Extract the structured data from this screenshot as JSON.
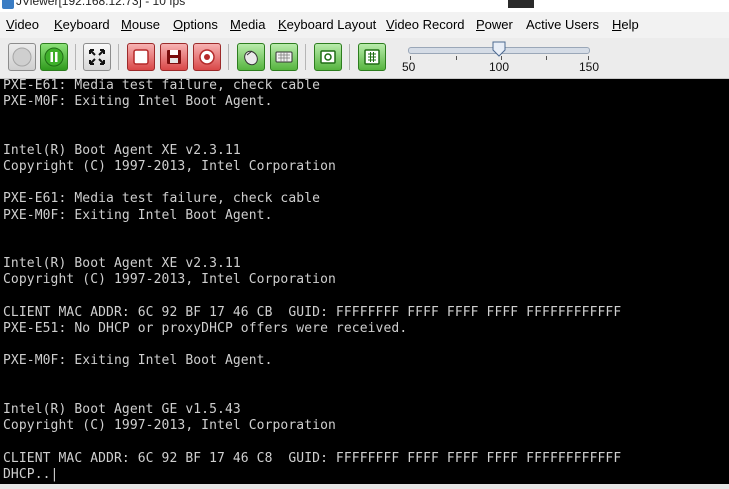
{
  "window": {
    "title": "JViewer[192.168.12.73] - 10 fps"
  },
  "menu": [
    {
      "label": "Video",
      "mnemonic": "V",
      "rest": "ideo"
    },
    {
      "label": "Keyboard",
      "mnemonic": "K",
      "rest": "eyboard"
    },
    {
      "label": "Mouse",
      "mnemonic": "M",
      "rest": "ouse"
    },
    {
      "label": "Options",
      "mnemonic": "O",
      "rest": "ptions"
    },
    {
      "label": "Media",
      "mnemonic": "M",
      "rest": "edia"
    },
    {
      "label": "Keyboard Layout",
      "mnemonic": "K",
      "rest": "eyboard Layout"
    },
    {
      "label": "Video Record",
      "mnemonic": "V",
      "rest": "ideo Record"
    },
    {
      "label": "Power",
      "mnemonic": "P",
      "rest": "ower"
    },
    {
      "label": "Active Users",
      "mnemonic": "",
      "rest": "Active Users"
    },
    {
      "label": "Help",
      "mnemonic": "H",
      "rest": "elp"
    }
  ],
  "toolbar": {
    "icons": [
      "play-icon",
      "pause-icon",
      "fullscreen-icon",
      "stop-record-icon",
      "save-icon",
      "settings-icon",
      "mouse-icon",
      "keyboard-icon",
      "virtual-media-icon",
      "soft-keyboard-icon"
    ],
    "zoom": {
      "min_label": "50",
      "mid_label": "100",
      "max_label": "150",
      "value": 100
    }
  },
  "console": {
    "lines": [
      "PXE-E61: Media test failure, check cable",
      "PXE-M0F: Exiting Intel Boot Agent.",
      "",
      "",
      "Intel(R) Boot Agent XE v2.3.11",
      "Copyright (C) 1997-2013, Intel Corporation",
      "",
      "PXE-E61: Media test failure, check cable",
      "PXE-M0F: Exiting Intel Boot Agent.",
      "",
      "",
      "Intel(R) Boot Agent XE v2.3.11",
      "Copyright (C) 1997-2013, Intel Corporation",
      "",
      "CLIENT MAC ADDR: 6C 92 BF 17 46 CB  GUID: FFFFFFFF FFFF FFFF FFFF FFFFFFFFFFFF",
      "PXE-E51: No DHCP or proxyDHCP offers were received.",
      "",
      "PXE-M0F: Exiting Intel Boot Agent.",
      "",
      "",
      "Intel(R) Boot Agent GE v1.5.43",
      "Copyright (C) 1997-2013, Intel Corporation",
      "",
      "CLIENT MAC ADDR: 6C 92 BF 17 46 C8  GUID: FFFFFFFF FFFF FFFF FFFF FFFFFFFFFFFF",
      "DHCP..|"
    ]
  }
}
